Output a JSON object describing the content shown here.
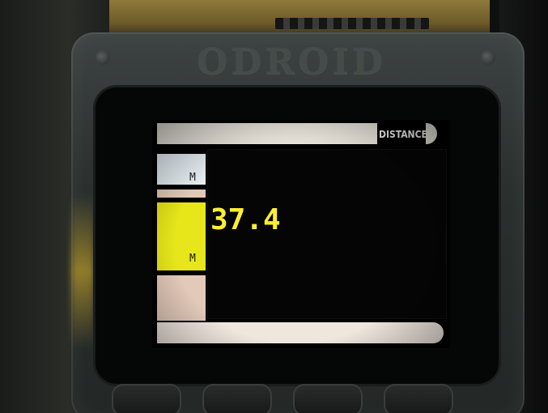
{
  "device": {
    "logo_text": "ODROID"
  },
  "screen": {
    "header_label": "DISTANCE",
    "unit_label_1": "M",
    "unit_label_2": "M",
    "reading_value": "37.4"
  },
  "colors": {
    "reading_yellow": "#ffee33",
    "block_yellow": "#e6e61a",
    "light_bar": "#ece8df",
    "light_blue_bar": "#e6eef2",
    "beige_bar": "#e2c9b8"
  }
}
